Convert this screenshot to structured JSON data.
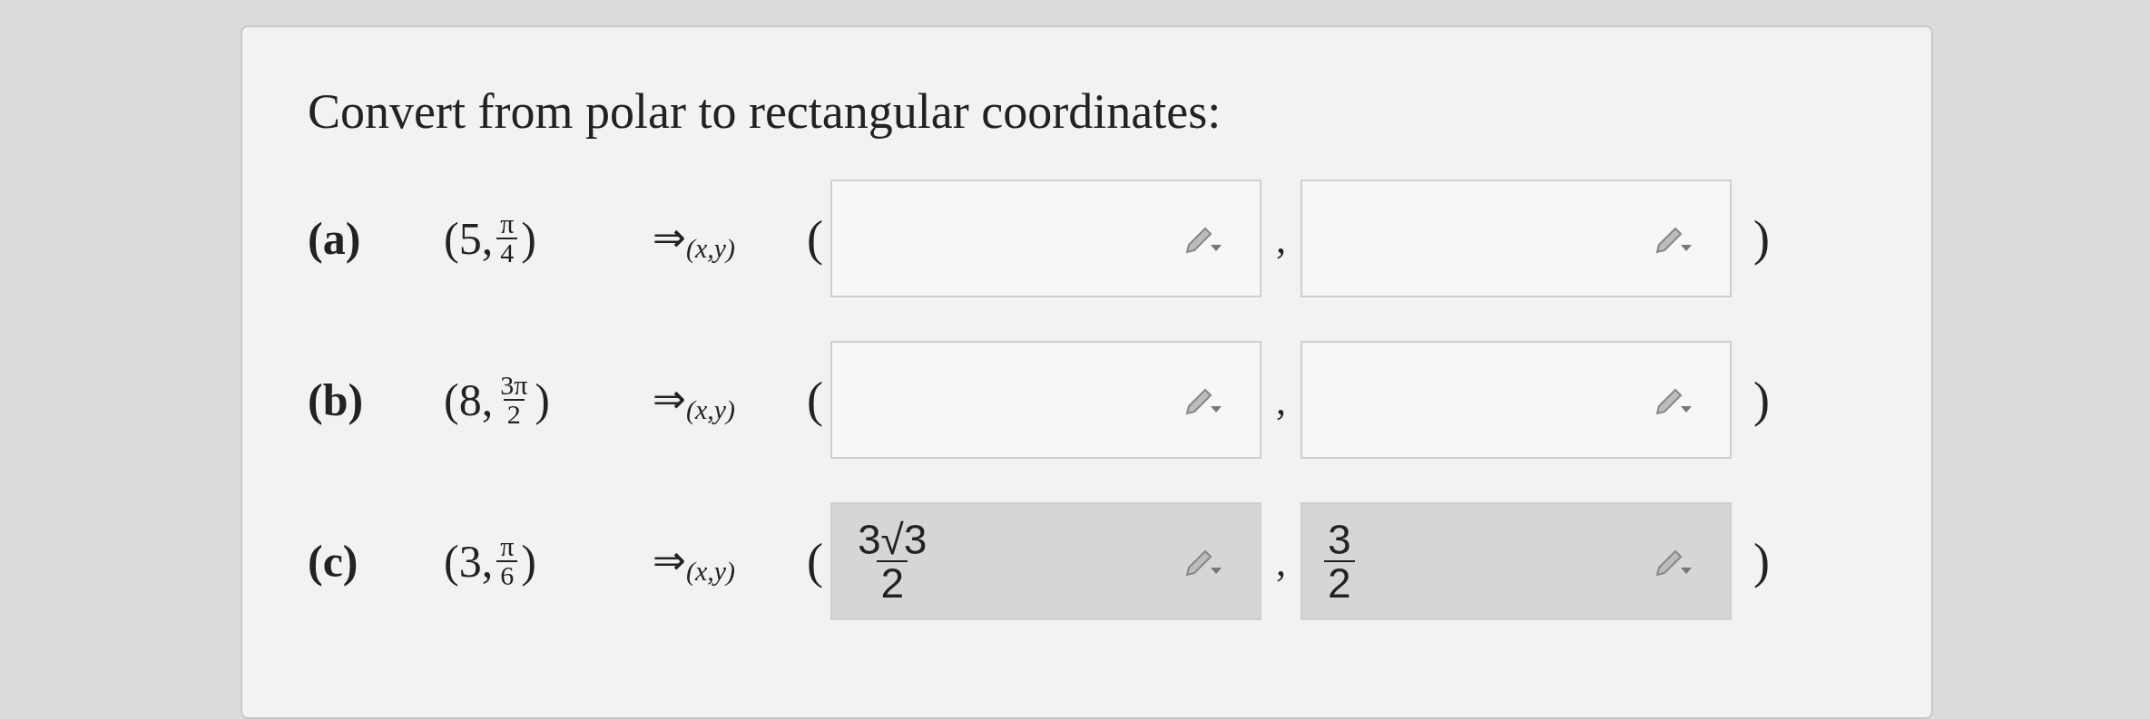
{
  "prompt": "Convert from polar to rectangular coordinates:",
  "parts": [
    {
      "label": "(a)",
      "open": "(",
      "r": "5",
      "comma": ",",
      "theta": {
        "numerator": "π",
        "denominator": "4"
      },
      "close": ")",
      "arrow": "⇒",
      "target": "(x,y)",
      "answer_open": "(",
      "answer_comma": ",",
      "answer_close": ")",
      "fields": [
        {
          "disabled": false
        },
        {
          "disabled": false
        }
      ]
    },
    {
      "label": "(b)",
      "open": "(",
      "r": "8",
      "comma": ",",
      "theta": {
        "numerator": "3π",
        "denominator": "2"
      },
      "close": ")",
      "arrow": "⇒",
      "target": "(x,y)",
      "answer_open": "(",
      "answer_comma": ",",
      "answer_close": ")",
      "fields": [
        {
          "disabled": false
        },
        {
          "disabled": false
        }
      ]
    },
    {
      "label": "(c)",
      "open": "(",
      "r": "3",
      "comma": ",",
      "theta": {
        "numerator": "π",
        "denominator": "6"
      },
      "close": ")",
      "arrow": "⇒",
      "target": "(x,y)",
      "answer_open": "(",
      "answer_comma": ",",
      "answer_close": ")",
      "fields": [
        {
          "disabled": true,
          "value": {
            "numerator": "3√3",
            "denominator": "2"
          }
        },
        {
          "disabled": true,
          "value": {
            "numerator": "3",
            "denominator": "2"
          }
        }
      ]
    }
  ]
}
